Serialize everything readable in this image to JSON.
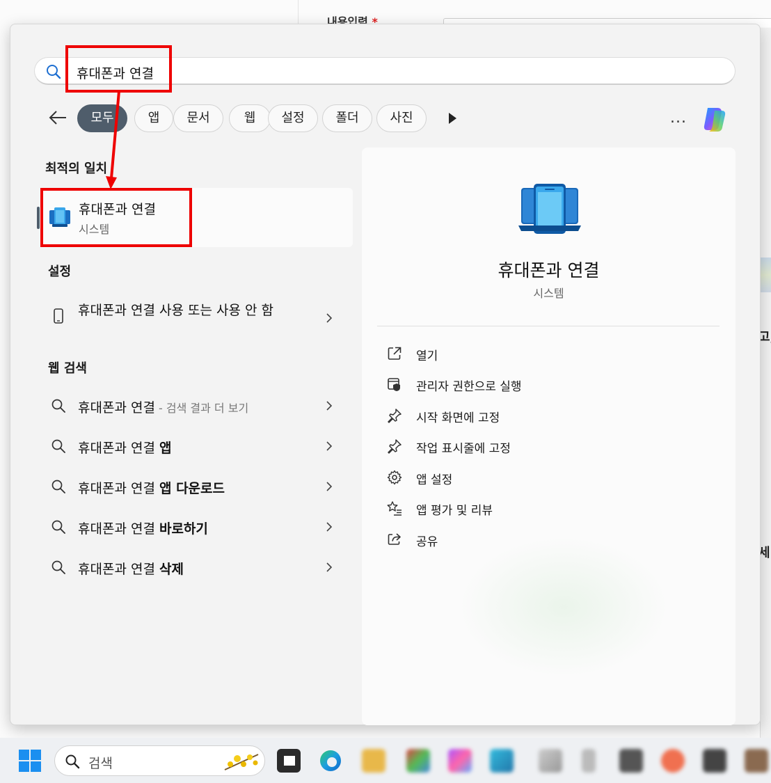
{
  "background": {
    "form_label": "내용입력",
    "required_mark": "*",
    "edge_texts": [
      "고,",
      "세"
    ]
  },
  "search": {
    "query": "휴대폰과 연결"
  },
  "filters": {
    "chips": [
      "모두",
      "앱",
      "문서",
      "웹",
      "설정",
      "폴더",
      "사진"
    ],
    "active_index": 0,
    "more_label": "..."
  },
  "sections": {
    "best_match": "최적의 일치",
    "settings": "설정",
    "web_search": "웹 검색"
  },
  "best_match": {
    "title": "휴대폰과 연결",
    "subtitle": "시스템"
  },
  "settings_items": [
    {
      "label": "휴대폰과 연결 사용 또는 사용 안 함"
    }
  ],
  "web_items": [
    {
      "prefix": "휴대폰과 연결",
      "suffix": "",
      "muted": " - 검색 결과 더 보기"
    },
    {
      "prefix": "휴대폰과 연결 ",
      "suffix": "앱",
      "muted": ""
    },
    {
      "prefix": "휴대폰과 연결 ",
      "suffix": "앱 다운로드",
      "muted": ""
    },
    {
      "prefix": "휴대폰과 연결 ",
      "suffix": "바로하기",
      "muted": ""
    },
    {
      "prefix": "휴대폰과 연결 ",
      "suffix": "삭제",
      "muted": ""
    }
  ],
  "detail": {
    "title": "휴대폰과 연결",
    "subtitle": "시스템",
    "actions": [
      {
        "label": "열기",
        "icon": "open-external-icon"
      },
      {
        "label": "관리자 권한으로 실행",
        "icon": "shield-admin-icon"
      },
      {
        "label": "시작 화면에 고정",
        "icon": "pin-icon"
      },
      {
        "label": "작업 표시줄에 고정",
        "icon": "pin-icon"
      },
      {
        "label": "앱 설정",
        "icon": "gear-icon"
      },
      {
        "label": "앱 평가 및 리뷰",
        "icon": "star-list-icon"
      },
      {
        "label": "공유",
        "icon": "share-icon"
      }
    ]
  },
  "taskbar": {
    "search_placeholder": "검색"
  },
  "colors": {
    "accent": "#4f5d6b",
    "annotation_red": "#ee0000",
    "panel_bg": "#f3f3f3"
  }
}
